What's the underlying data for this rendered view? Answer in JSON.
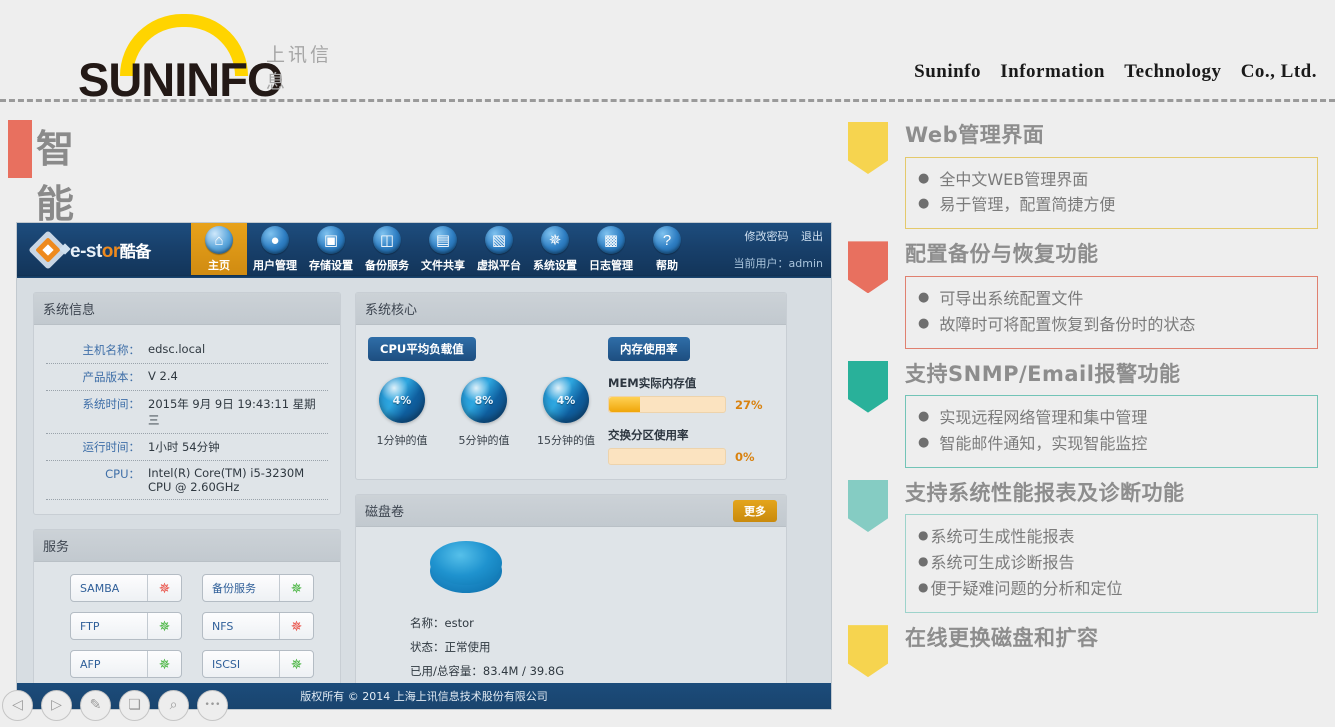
{
  "brand": {
    "logo_word": "SUNINFO",
    "logo_cn": "上讯信息",
    "company_parts": [
      "Suninfo",
      "Information",
      "Technology",
      "Co., Ltd."
    ],
    "accent_yellow": "#FFD400",
    "accent_red": "#E8705F"
  },
  "page": {
    "title": "智能管理平台"
  },
  "app": {
    "logo_text_a": "e-st",
    "logo_text_b": "or",
    "logo_text_cn": "酷备",
    "nav": [
      {
        "label": "主页",
        "icon": "home-icon",
        "glyph": "⌂",
        "active": true
      },
      {
        "label": "用户管理",
        "icon": "user-icon",
        "glyph": "👤",
        "active": false
      },
      {
        "label": "存储设置",
        "icon": "storage-icon",
        "glyph": "🖫",
        "active": false
      },
      {
        "label": "备份服务",
        "icon": "backup-icon",
        "glyph": "🗐",
        "active": false
      },
      {
        "label": "文件共享",
        "icon": "file-share-icon",
        "glyph": "🖹",
        "active": false
      },
      {
        "label": "虚拟平台",
        "icon": "virtual-platform-icon",
        "glyph": "▣",
        "active": false
      },
      {
        "label": "系统设置",
        "icon": "gear-icon",
        "glyph": "✻",
        "active": false
      },
      {
        "label": "日志管理",
        "icon": "log-icon",
        "glyph": "🗒",
        "active": false
      },
      {
        "label": "帮助",
        "icon": "help-icon",
        "glyph": "?",
        "active": false
      }
    ],
    "change_password": "修改密码",
    "logout": "退出",
    "current_user": "当前用户：admin",
    "footer": "版权所有 © 2014 上海上讯信息技术股份有限公司"
  },
  "system_info": {
    "title": "系统信息",
    "rows": [
      {
        "key": "主机名称：",
        "value": "edsc.local"
      },
      {
        "key": "产品版本：",
        "value": "V 2.4"
      },
      {
        "key": "系统时间：",
        "value": "2015年 9月 9日 19:43:11 星期三"
      },
      {
        "key": "运行时间：",
        "value": "1小时 54分钟"
      },
      {
        "key": "CPU：",
        "value": "Intel(R) Core(TM) i5-3230M CPU @ 2.60GHz"
      }
    ]
  },
  "system_core": {
    "title": "系统核心",
    "cpu_pill": "CPU平均负载值",
    "mem_pill": "内存使用率",
    "gauges": [
      {
        "value": "4%",
        "label": "1分钟的值"
      },
      {
        "value": "8%",
        "label": "5分钟的值"
      },
      {
        "value": "4%",
        "label": "15分钟的值"
      }
    ],
    "meters": [
      {
        "label": "MEM实际内存值",
        "percent": "27%",
        "fill": 27
      },
      {
        "label": "交换分区使用率",
        "percent": "0%",
        "fill": 0
      }
    ]
  },
  "services": {
    "title": "服务",
    "items": [
      {
        "name": "SAMBA",
        "status_color": "#e8463c"
      },
      {
        "name": "备份服务",
        "status_color": "#3cb034"
      },
      {
        "name": "FTP",
        "status_color": "#3cb034"
      },
      {
        "name": "NFS",
        "status_color": "#e8463c"
      },
      {
        "name": "AFP",
        "status_color": "#3cb034"
      },
      {
        "name": "ISCSI",
        "status_color": "#3cb034"
      }
    ]
  },
  "disk_volume": {
    "title": "磁盘卷",
    "more": "更多",
    "name_line": "名称：estor",
    "status_line": "状态：正常使用",
    "capacity_line": "已用/总容量：83.4M / 39.8G"
  },
  "features": [
    {
      "heading": "Web管理界面",
      "color": "#F6D44F",
      "border": "#e4c96b",
      "bullets": [
        "全中文WEB管理界面",
        "易于管理，配置简捷方便"
      ],
      "style": "spaced",
      "has_box": true
    },
    {
      "heading": "配置备份与恢复功能",
      "color": "#E8705F",
      "border": "#e0806f",
      "bullets": [
        "可导出系统配置文件",
        "故障时可将配置恢复到备份时的状态"
      ],
      "style": "spaced",
      "has_box": true
    },
    {
      "heading": "支持SNMP/Email报警功能",
      "color": "#29B19A",
      "border": "#72c4b7",
      "bullets": [
        "实现远程网络管理和集中管理",
        "智能邮件通知，实现智能监控"
      ],
      "style": "spaced",
      "has_box": true
    },
    {
      "heading": "支持系统性能报表及诊断功能",
      "color": "#85CCC3",
      "border": "#9dd3cb",
      "bullets": [
        "系统可生成性能报表",
        "系统可生成诊断报告",
        "便于疑难问题的分析和定位"
      ],
      "style": "tight",
      "has_box": true
    },
    {
      "heading": "在线更换磁盘和扩容",
      "color": "#F6D44F",
      "border": "#e4c96b",
      "bullets": [],
      "style": "spaced",
      "has_box": false
    }
  ],
  "toolbar": [
    {
      "name": "previous-button",
      "glyph": "◁"
    },
    {
      "name": "play-button",
      "glyph": "▷"
    },
    {
      "name": "pen-button",
      "glyph": "✎"
    },
    {
      "name": "shapes-button",
      "glyph": "❏"
    },
    {
      "name": "zoom-button",
      "glyph": "⌕"
    },
    {
      "name": "more-options-button",
      "glyph": "•••"
    }
  ]
}
